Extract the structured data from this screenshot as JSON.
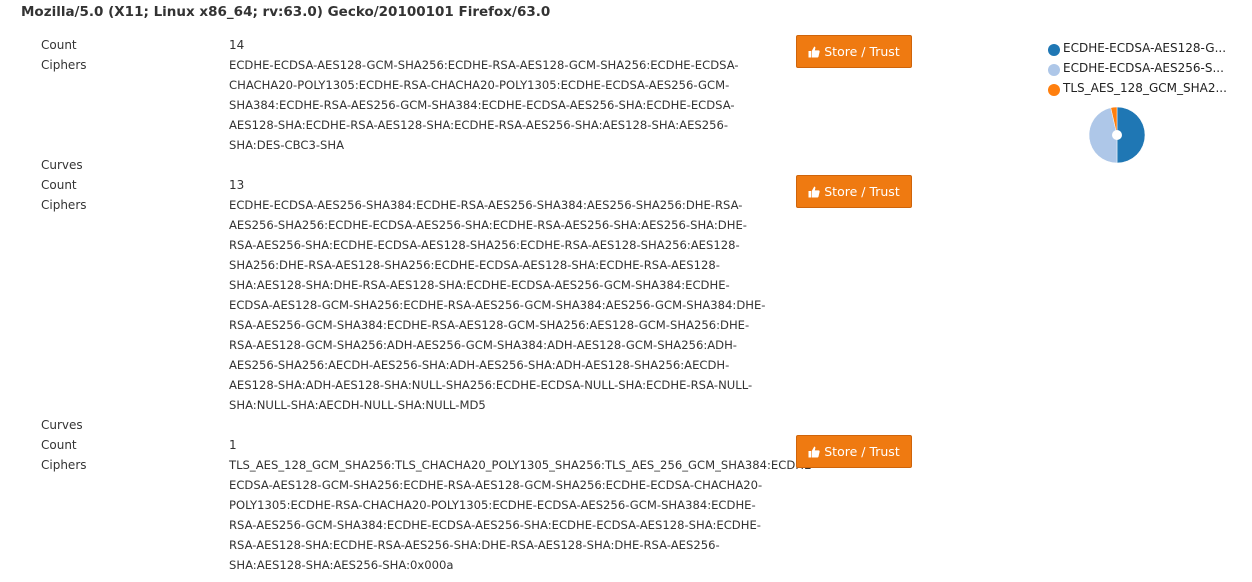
{
  "user_agent": "Mozilla/5.0 (X11; Linux x86_64; rv:63.0) Gecko/20100101 Firefox/63.0",
  "labels": {
    "count": "Count",
    "ciphers": "Ciphers",
    "curves": "Curves"
  },
  "button_label": "Store / Trust",
  "icons": {
    "store_button": "thumbs-up-icon"
  },
  "fingerprints": [
    {
      "count": "14",
      "cipher_lines": [
        "ECDHE-ECDSA-AES128-GCM-SHA256:ECDHE-RSA-AES128-GCM-SHA256:ECDHE-ECDSA-",
        "CHACHA20-POLY1305:ECDHE-RSA-CHACHA20-POLY1305:ECDHE-ECDSA-AES256-GCM-",
        "SHA384:ECDHE-RSA-AES256-GCM-SHA384:ECDHE-ECDSA-AES256-SHA:ECDHE-ECDSA-",
        "AES128-SHA:ECDHE-RSA-AES128-SHA:ECDHE-RSA-AES256-SHA:AES128-SHA:AES256-",
        "SHA:DES-CBC3-SHA"
      ],
      "curves": ""
    },
    {
      "count": "13",
      "cipher_lines": [
        "ECDHE-ECDSA-AES256-SHA384:ECDHE-RSA-AES256-SHA384:AES256-SHA256:DHE-RSA-",
        "AES256-SHA256:ECDHE-ECDSA-AES256-SHA:ECDHE-RSA-AES256-SHA:AES256-SHA:DHE-",
        "RSA-AES256-SHA:ECDHE-ECDSA-AES128-SHA256:ECDHE-RSA-AES128-SHA256:AES128-",
        "SHA256:DHE-RSA-AES128-SHA256:ECDHE-ECDSA-AES128-SHA:ECDHE-RSA-AES128-",
        "SHA:AES128-SHA:DHE-RSA-AES128-SHA:ECDHE-ECDSA-AES256-GCM-SHA384:ECDHE-",
        "ECDSA-AES128-GCM-SHA256:ECDHE-RSA-AES256-GCM-SHA384:AES256-GCM-SHA384:DHE-",
        "RSA-AES256-GCM-SHA384:ECDHE-RSA-AES128-GCM-SHA256:AES128-GCM-SHA256:DHE-",
        "RSA-AES128-GCM-SHA256:ADH-AES256-GCM-SHA384:ADH-AES128-GCM-SHA256:ADH-",
        "AES256-SHA256:AECDH-AES256-SHA:ADH-AES256-SHA:ADH-AES128-SHA256:AECDH-",
        "AES128-SHA:ADH-AES128-SHA:NULL-SHA256:ECDHE-ECDSA-NULL-SHA:ECDHE-RSA-NULL-",
        "SHA:NULL-SHA:AECDH-NULL-SHA:NULL-MD5"
      ],
      "curves": ""
    },
    {
      "count": "1",
      "cipher_lines": [
        "TLS_AES_128_GCM_SHA256:TLS_CHACHA20_POLY1305_SHA256:TLS_AES_256_GCM_SHA384:ECDHE-",
        "ECDSA-AES128-GCM-SHA256:ECDHE-RSA-AES128-GCM-SHA256:ECDHE-ECDSA-CHACHA20-",
        "POLY1305:ECDHE-RSA-CHACHA20-POLY1305:ECDHE-ECDSA-AES256-GCM-SHA384:ECDHE-",
        "RSA-AES256-GCM-SHA384:ECDHE-ECDSA-AES256-SHA:ECDHE-ECDSA-AES128-SHA:ECDHE-",
        "RSA-AES128-SHA:ECDHE-RSA-AES256-SHA:DHE-RSA-AES128-SHA:DHE-RSA-AES256-",
        "SHA:AES128-SHA:AES256-SHA:0x000a"
      ]
    }
  ],
  "pie": {
    "legend": [
      {
        "label": "ECDHE-ECDSA-AES128-G...",
        "color": "#1f77b4"
      },
      {
        "label": "ECDHE-ECDSA-AES256-S...",
        "color": "#aec7e8"
      },
      {
        "label": "TLS_AES_128_GCM_SHA2...",
        "color": "#ff7f0e"
      }
    ],
    "values": [
      14,
      13,
      1
    ],
    "colors": [
      "#1f77b4",
      "#aec7e8",
      "#ff7f0e"
    ]
  }
}
